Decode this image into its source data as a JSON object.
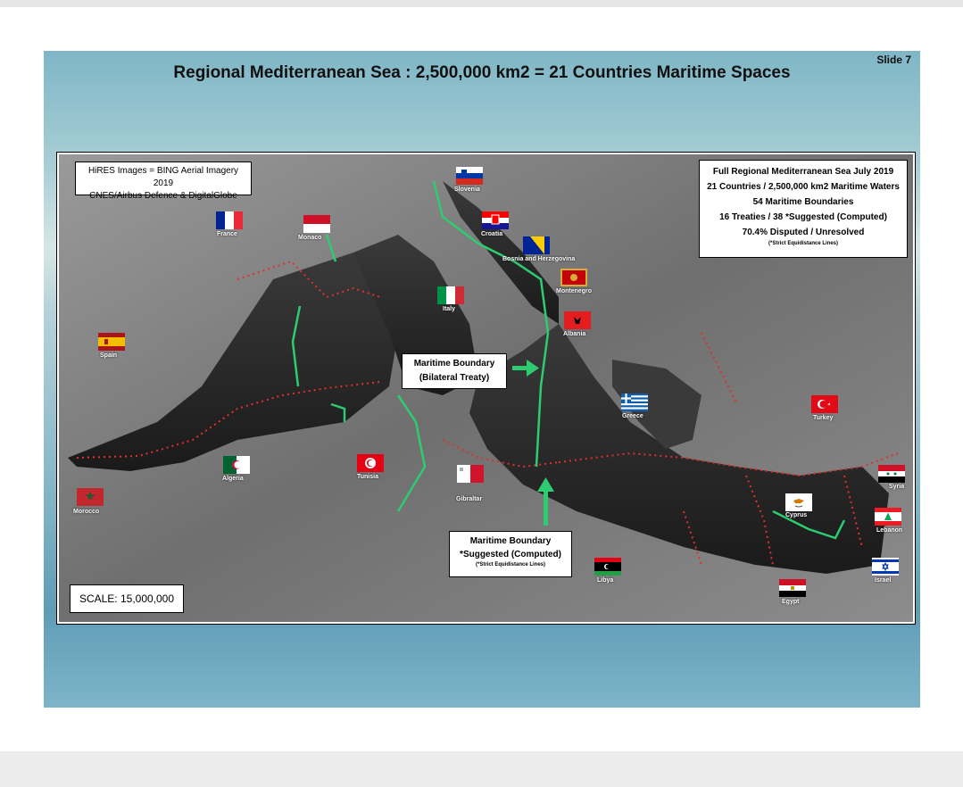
{
  "slide": {
    "title": "Regional Mediterranean Sea : 2,500,000 km2 = 21 Countries Maritime Spaces",
    "number": "Slide 7"
  },
  "info_left": {
    "line1": "HiRES Images = BING Aerial Imagery 2019",
    "line2": "CNES/Airbus Defence & DigitalGlobe"
  },
  "info_right": {
    "line1": "Full Regional Mediterranean Sea July 2019",
    "line2": "21 Countries / 2,500,000 km2 Maritime Waters",
    "line3": "54 Maritime Boundaries",
    "line4": "16 Treaties / 38 *Suggested (Computed)",
    "line5": "70.4% Disputed / Unresolved",
    "note": "(*Strict Equidistance Lines)"
  },
  "scale": "SCALE: 15,000,000",
  "callout_treaty": {
    "line1": "Maritime Boundary",
    "line2": "(Bilateral Treaty)"
  },
  "callout_suggested": {
    "line1": "Maritime Boundary",
    "line2": "*Suggested (Computed)",
    "note": "(*Strict Equidistance Lines)"
  },
  "colors": {
    "treaty_line": "#2ecc71",
    "suggested_line": "#e03030",
    "land": "#8a8a8a",
    "sea": "#2a2a2a"
  },
  "countries": [
    {
      "name": "Slovenia"
    },
    {
      "name": "France"
    },
    {
      "name": "Monaco"
    },
    {
      "name": "Croatia"
    },
    {
      "name": "Bosnia and Herzegovina"
    },
    {
      "name": "Montenegro"
    },
    {
      "name": "Italy"
    },
    {
      "name": "Albania"
    },
    {
      "name": "Spain"
    },
    {
      "name": "Greece"
    },
    {
      "name": "Turkey"
    },
    {
      "name": "Algeria"
    },
    {
      "name": "Tunisia"
    },
    {
      "name": "Gibraltar"
    },
    {
      "name": "Syria"
    },
    {
      "name": "Morocco"
    },
    {
      "name": "Cyprus"
    },
    {
      "name": "Lebanon"
    },
    {
      "name": "Libya"
    },
    {
      "name": "Israel"
    },
    {
      "name": "Egypt"
    }
  ]
}
